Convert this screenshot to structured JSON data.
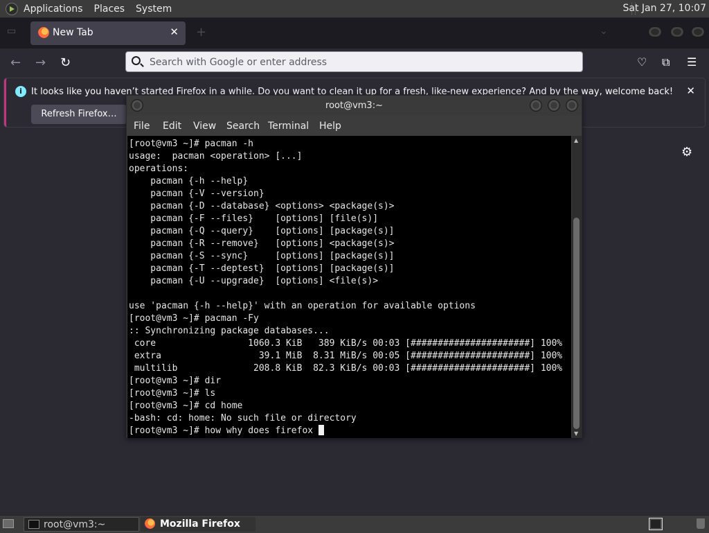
{
  "system_panel": {
    "menus": [
      "Applications",
      "Places",
      "System"
    ],
    "clock": "Sat Jan 27, 10:07"
  },
  "browser": {
    "tab": {
      "title": "New Tab",
      "close_glyph": "✕"
    },
    "new_tab_glyph": "+",
    "url_placeholder": "Search with Google or enter address",
    "nav": {
      "back": "←",
      "forward": "→",
      "reload": "↻"
    },
    "notification": {
      "message": "It looks like you haven’t started Firefox in a while. Do you want to clean it up for a fresh, like-new experience? And by the way, welcome back!",
      "button": "Refresh Firefox…",
      "close_glyph": "✕"
    },
    "icons": [
      "pocket-icon",
      "extensions-icon",
      "menu-icon",
      "gear-icon"
    ]
  },
  "terminal": {
    "title": "root@vm3:~",
    "menu": [
      "File",
      "Edit",
      "View",
      "Search",
      "Terminal",
      "Help"
    ],
    "lines": [
      "[root@vm3 ~]# pacman -h",
      "usage:  pacman <operation> [...]",
      "operations:",
      "    pacman {-h --help}",
      "    pacman {-V --version}",
      "    pacman {-D --database} <options> <package(s)>",
      "    pacman {-F --files}    [options] [file(s)]",
      "    pacman {-Q --query}    [options] [package(s)]",
      "    pacman {-R --remove}   [options] <package(s)>",
      "    pacman {-S --sync}     [options] [package(s)]",
      "    pacman {-T --deptest}  [options] [package(s)]",
      "    pacman {-U --upgrade}  [options] <file(s)>",
      "",
      "use 'pacman {-h --help}' with an operation for available options",
      "[root@vm3 ~]# pacman -Fy",
      ":: Synchronizing package databases...",
      " core                 1060.3 KiB   389 KiB/s 00:03 [######################] 100%",
      " extra                  39.1 MiB  8.31 MiB/s 00:05 [######################] 100%",
      " multilib              208.8 KiB  82.3 KiB/s 00:03 [######################] 100%",
      "[root@vm3 ~]# dir",
      "[root@vm3 ~]# ls",
      "[root@vm3 ~]# cd home",
      "-bash: cd: home: No such file or directory"
    ],
    "prompt": "[root@vm3 ~]# ",
    "current_input": "how why does firefox "
  },
  "taskbar": {
    "tasks": [
      {
        "label": "root@vm3:~"
      },
      {
        "label": "Mozilla Firefox"
      }
    ]
  }
}
